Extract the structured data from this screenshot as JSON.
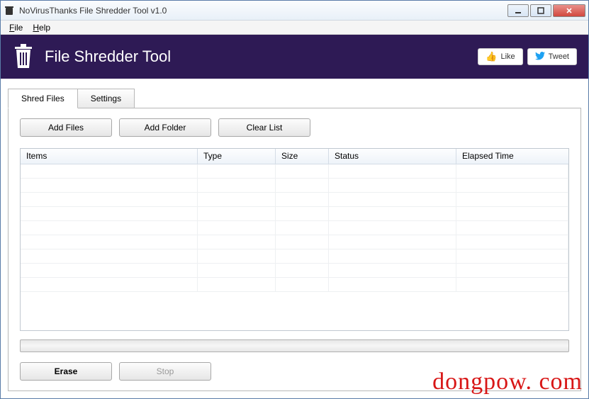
{
  "window": {
    "title": "NoVirusThanks File Shredder Tool v1.0"
  },
  "menu": {
    "file": "File",
    "help": "Help"
  },
  "header": {
    "title": "File Shredder Tool",
    "like": "Like",
    "tweet": "Tweet"
  },
  "tabs": {
    "shred": "Shred Files",
    "settings": "Settings"
  },
  "buttons": {
    "add_files": "Add Files",
    "add_folder": "Add Folder",
    "clear_list": "Clear List",
    "erase": "Erase",
    "stop": "Stop"
  },
  "columns": {
    "items": "Items",
    "type": "Type",
    "size": "Size",
    "status": "Status",
    "elapsed": "Elapsed Time"
  },
  "watermark": "dongpow. com"
}
